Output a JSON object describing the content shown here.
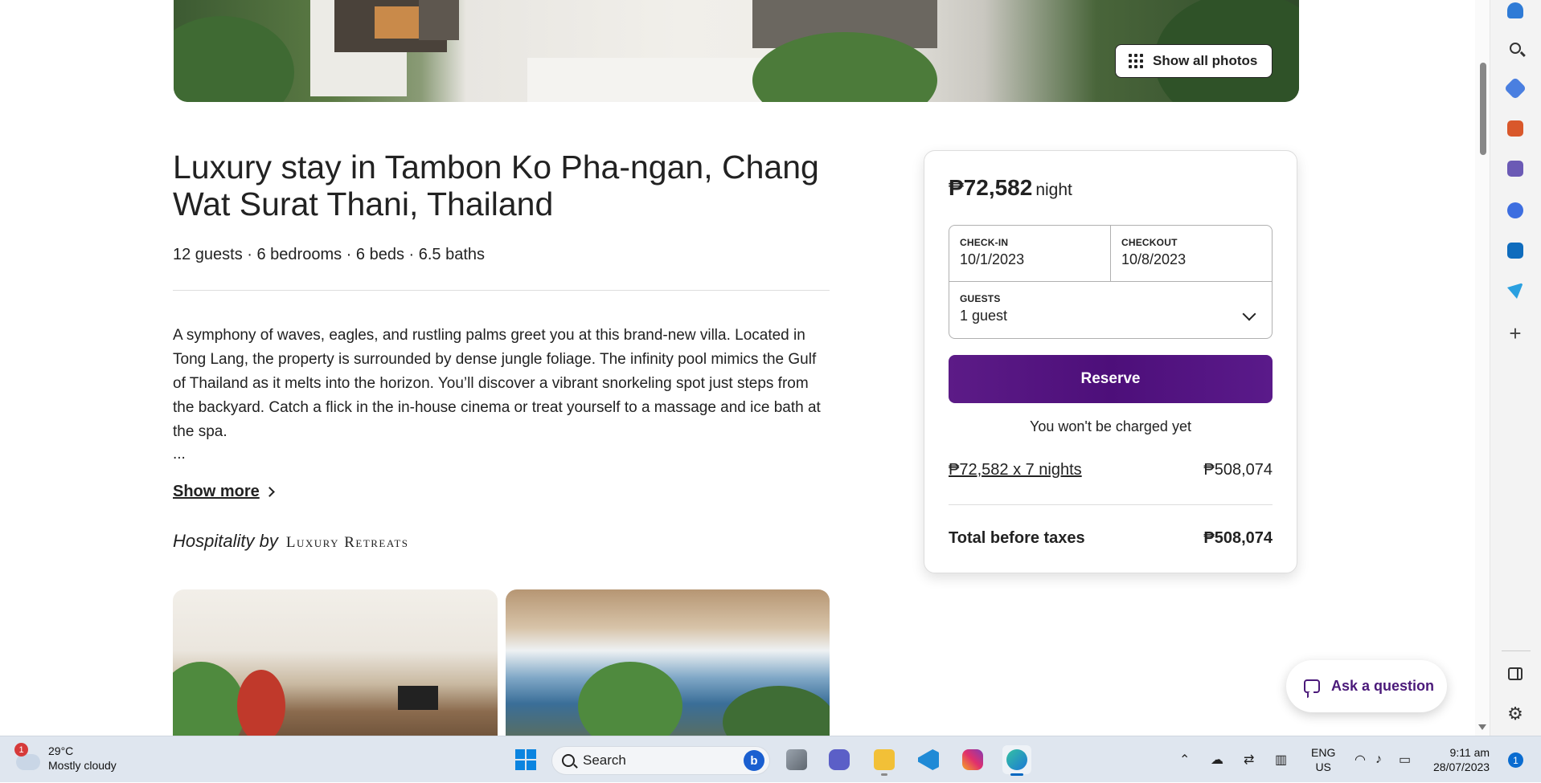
{
  "hero": {
    "show_photos_label": "Show all photos"
  },
  "listing": {
    "title": "Luxury stay in Tambon Ko Pha-ngan, Chang Wat Surat Thani, Thailand",
    "meta": "12 guests · 6 bedrooms · 6 beds · 6.5 baths",
    "description": "A symphony of waves, eagles, and rustling palms greet you at this brand-new villa. Located in Tong Lang, the property is surrounded by dense jungle foliage. The infinity pool mimics the Gulf of Thailand as it melts into the horizon. You’ll discover a vibrant snorkeling spot just steps from the backyard. Catch a flick in the in-house cinema or treat yourself to a massage and ice bath at the spa.",
    "ellipsis": "...",
    "show_more": "Show more",
    "hospitality_prefix": "Hospitality by",
    "hospitality_brand": "Luxury Retreats"
  },
  "booking": {
    "price": "₱72,582",
    "price_unit": "night",
    "checkin_label": "CHECK-IN",
    "checkin_value": "10/1/2023",
    "checkout_label": "CHECKOUT",
    "checkout_value": "10/8/2023",
    "guests_label": "GUESTS",
    "guests_value": "1 guest",
    "reserve_label": "Reserve",
    "no_charge": "You won't be charged yet",
    "nightly_calc": "₱72,582 x 7 nights",
    "nightly_total": "₱508,074",
    "total_label": "Total before taxes",
    "total_value": "₱508,074",
    "accent_color": "#4d0f7a"
  },
  "ask_question": "Ask a question",
  "taskbar": {
    "weather_badge": "1",
    "temperature": "29°C",
    "condition": "Mostly cloudy",
    "search_placeholder": "Search",
    "bing": "b",
    "lang_top": "ENG",
    "lang_bottom": "US",
    "time": "9:11 am",
    "date": "28/07/2023",
    "notifications": "1"
  }
}
